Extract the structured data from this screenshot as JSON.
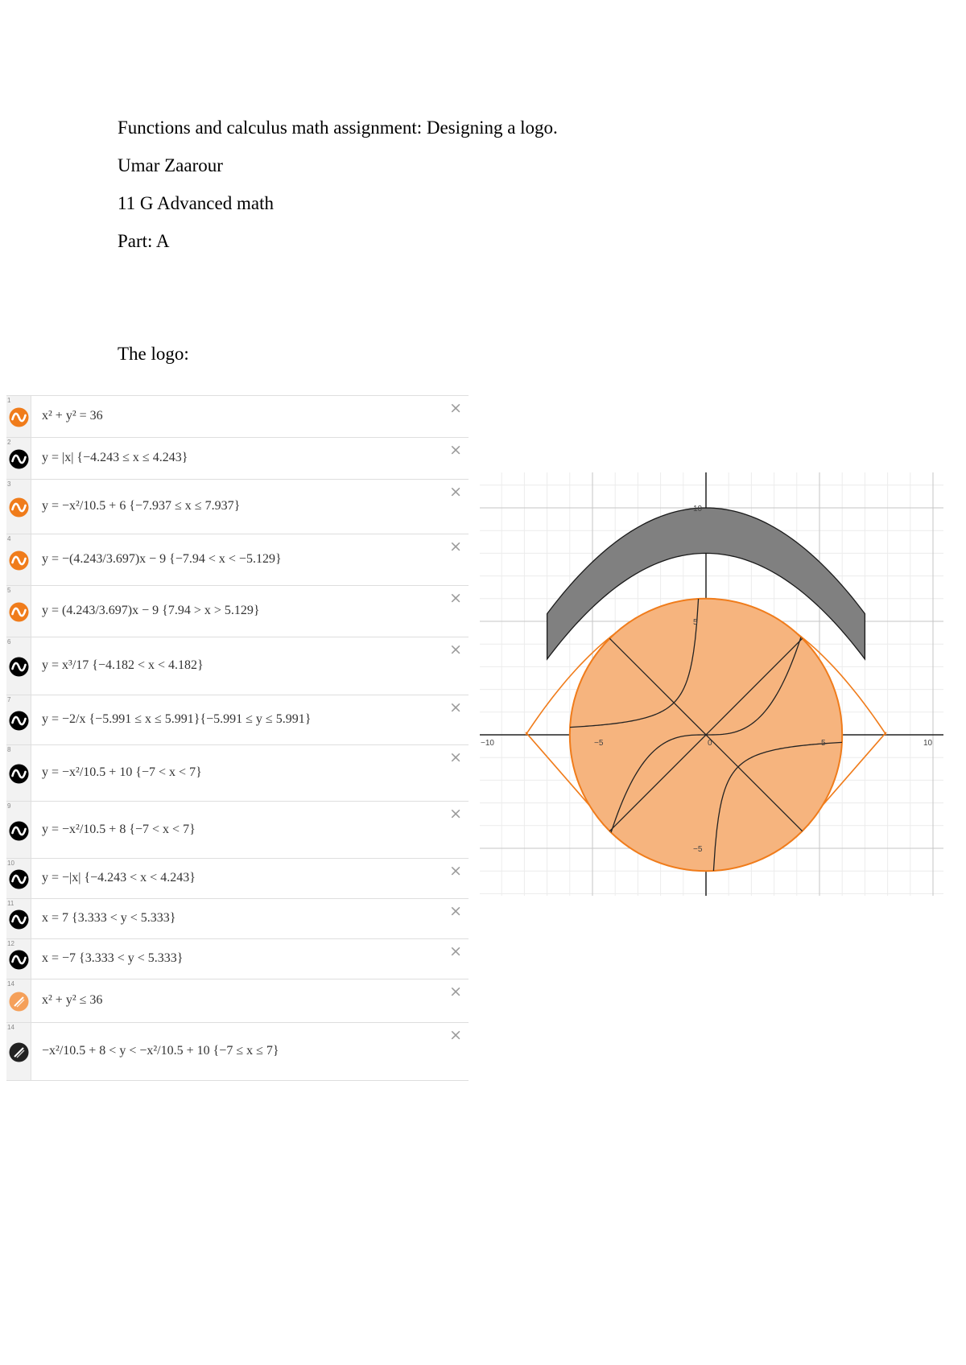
{
  "document": {
    "title_line": "Functions and calculus math assignment: Designing a logo.",
    "author": "Umar Zaarour",
    "class_name": "11 G Advanced math",
    "part": "Part: A",
    "logo_heading": "The logo:"
  },
  "expression_list": {
    "close_symbol": "×",
    "items": [
      {
        "index": "1",
        "icon": "orange-wave-icon",
        "color": "#f07c1b",
        "expression": "x² + y² = 36"
      },
      {
        "index": "2",
        "icon": "black-wave-icon",
        "color": "#000000",
        "expression": "y = |x| {−4.243 ≤ x ≤ 4.243}"
      },
      {
        "index": "3",
        "icon": "orange-wave-icon",
        "color": "#f07c1b",
        "expression": "y = −x²/10.5 + 6 {−7.937 ≤ x ≤ 7.937}"
      },
      {
        "index": "4",
        "icon": "orange-wave-icon",
        "color": "#f07c1b",
        "expression": "y = −(4.243/3.697)x − 9 {−7.94 < x < −5.129}"
      },
      {
        "index": "5",
        "icon": "orange-wave-icon",
        "color": "#f07c1b",
        "expression": "y = (4.243/3.697)x − 9 {7.94 > x > 5.129}"
      },
      {
        "index": "6",
        "icon": "black-wave-icon",
        "color": "#000000",
        "expression": "y = x³/17 {−4.182 < x < 4.182}"
      },
      {
        "index": "7",
        "icon": "black-wave-icon",
        "color": "#000000",
        "expression": "y = −2/x {−5.991 ≤ x ≤ 5.991}{−5.991 ≤ y ≤ 5.991}"
      },
      {
        "index": "8",
        "icon": "black-wave-icon",
        "color": "#000000",
        "expression": "y = −x²/10.5 + 10 {−7 < x < 7}"
      },
      {
        "index": "9",
        "icon": "black-wave-icon",
        "color": "#000000",
        "expression": "y = −x²/10.5 + 8 {−7 < x < 7}"
      },
      {
        "index": "10",
        "icon": "black-wave-icon",
        "color": "#000000",
        "expression": "y = −|x| {−4.243 < x < 4.243}"
      },
      {
        "index": "11",
        "icon": "black-wave-icon",
        "color": "#000000",
        "expression": "x = 7 {3.333 < y < 5.333}"
      },
      {
        "index": "12",
        "icon": "black-wave-icon",
        "color": "#000000",
        "expression": "x = −7 {3.333 < y < 5.333}"
      },
      {
        "index": "14",
        "icon": "orange-shade-icon",
        "color": "#f5a05a",
        "expression": "x² + y² ≤ 36"
      },
      {
        "index": "14",
        "icon": "black-shade-icon",
        "color": "#222222",
        "expression": "−x²/10.5 + 8 < y < −x²/10.5 + 10 {−7 ≤ x ≤ 7}"
      }
    ]
  },
  "graph": {
    "x_ticks": [
      "−10",
      "−5",
      "0",
      "5",
      "10"
    ],
    "y_ticks": [
      "10",
      "5",
      "−5"
    ],
    "orange": "#f07c1b",
    "orange_fill": "#f6b47e",
    "band_fill": "#808080"
  }
}
